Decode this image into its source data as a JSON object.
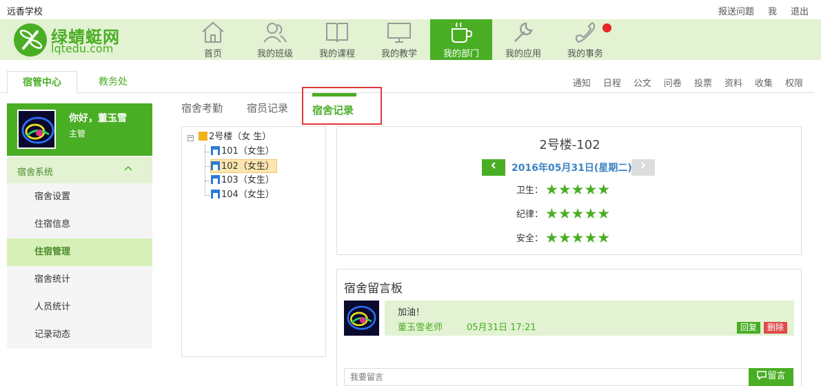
{
  "topbar": {
    "school_name": "远香学校",
    "links": [
      "报送问题",
      "我",
      "退出"
    ]
  },
  "logo": {
    "cn": "绿蜻蜓网",
    "en": "lqtedu.com"
  },
  "nav": {
    "items": [
      {
        "label": "首页",
        "icon": "home-icon"
      },
      {
        "label": "我的班级",
        "icon": "people-icon"
      },
      {
        "label": "我的课程",
        "icon": "book-icon"
      },
      {
        "label": "我的教学",
        "icon": "monitor-icon"
      },
      {
        "label": "我的部门",
        "icon": "cup-icon",
        "active": true
      },
      {
        "label": "我的应用",
        "icon": "wrench-icon"
      },
      {
        "label": "我的事务",
        "icon": "phone-icon"
      }
    ]
  },
  "tabs": {
    "active": "宿管中心",
    "inactive": "教务处"
  },
  "subnav": [
    "通知",
    "日程",
    "公文",
    "问卷",
    "投票",
    "资料",
    "收集",
    "权限"
  ],
  "user": {
    "greeting": "你好，董玉雪",
    "role": "主管"
  },
  "sidebar": {
    "section": "宿舍系统",
    "items": [
      {
        "label": "宿舍设置"
      },
      {
        "label": "住宿信息"
      },
      {
        "label": "住宿管理",
        "active": true
      },
      {
        "label": "宿舍统计"
      },
      {
        "label": "人员统计"
      },
      {
        "label": "记录动态"
      }
    ]
  },
  "content_tabs": [
    "宿舍考勤",
    "宿员记录",
    "宿舍记录"
  ],
  "tree": {
    "building": "2号楼（女 生）",
    "rooms": [
      "101（女生）",
      "102（女生）",
      "103（女生）",
      "104（女生）"
    ],
    "selected_index": 1
  },
  "record": {
    "room_title": "2号楼-102",
    "date": "2016年05月31日(星期二)",
    "scores": [
      {
        "label": "卫生：",
        "stars": 5
      },
      {
        "label": "纪律：",
        "stars": 5
      },
      {
        "label": "安全：",
        "stars": 5
      }
    ]
  },
  "message_board": {
    "title": "宿舍留言板",
    "messages": [
      {
        "text": "加油！",
        "author": "董玉雪老师",
        "time": "05月31日 17:21"
      }
    ],
    "reply_label": "回复",
    "delete_label": "删除",
    "input_placeholder": "我要留言",
    "post_label": "留言"
  },
  "colors": {
    "brand_green": "#4aae24",
    "light_green": "#e2f2d2",
    "highlight": "#e0363a",
    "date_blue": "#3c83c4"
  }
}
